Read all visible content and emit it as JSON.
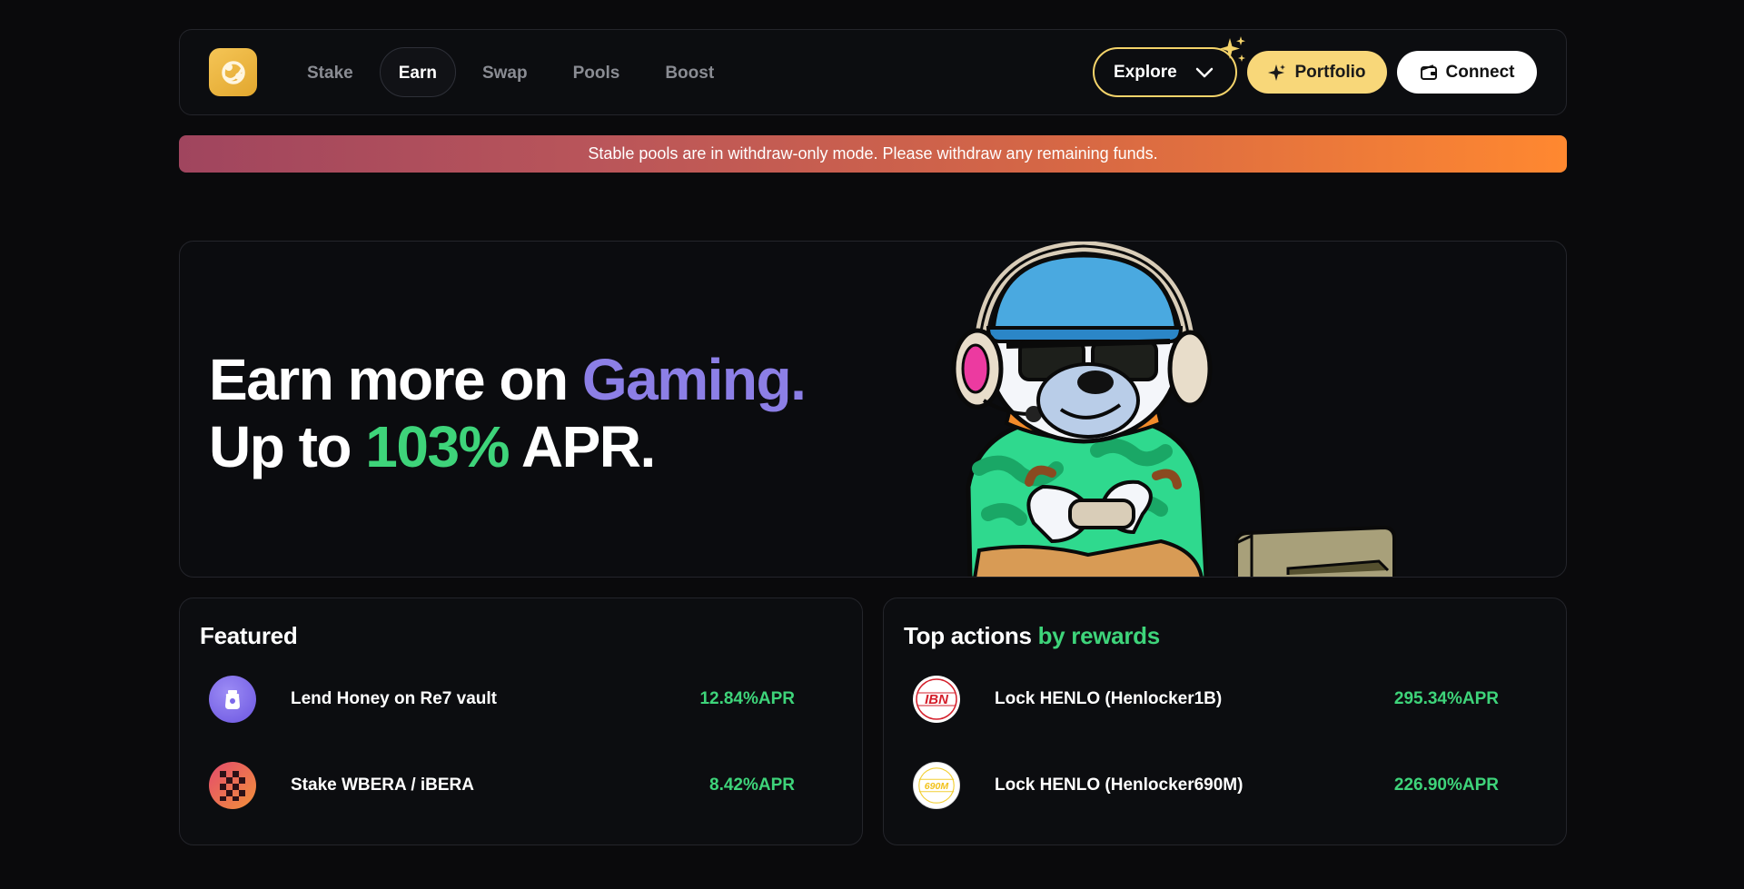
{
  "nav": {
    "links": [
      {
        "label": "Stake",
        "active": false
      },
      {
        "label": "Earn",
        "active": true
      },
      {
        "label": "Swap",
        "active": false
      },
      {
        "label": "Pools",
        "active": false
      },
      {
        "label": "Boost",
        "active": false
      }
    ],
    "explore_label": "Explore",
    "portfolio_label": "Portfolio",
    "connect_label": "Connect"
  },
  "banner": {
    "text": "Stable pools are in withdraw-only mode. Please withdraw any remaining funds."
  },
  "hero": {
    "line1_prefix": "Earn more on ",
    "line1_highlight": "Gaming.",
    "line2_prefix": "Up to ",
    "line2_highlight": "103%",
    "line2_suffix": " APR."
  },
  "featured": {
    "title": "Featured",
    "items": [
      {
        "label": "Lend Honey on Re7 vault",
        "apr": "12.84%APR",
        "icon": "honey-jar-icon"
      },
      {
        "label": "Stake WBERA / iBERA",
        "apr": "8.42%APR",
        "icon": "checker-icon"
      }
    ]
  },
  "top_actions": {
    "title_prefix": "Top actions ",
    "title_highlight": "by rewards",
    "items": [
      {
        "label": "Lock HENLO (Henlocker1B)",
        "apr": "295.34%APR",
        "icon": "ibn-logo",
        "icon_text": "IBN"
      },
      {
        "label": "Lock HENLO (Henlocker690M)",
        "apr": "226.90%APR",
        "icon": "690m-logo",
        "icon_text": "690M"
      }
    ]
  },
  "colors": {
    "accent_purple": "#8c7fe6",
    "accent_green": "#3ed47a",
    "accent_yellow": "#f8d779"
  }
}
